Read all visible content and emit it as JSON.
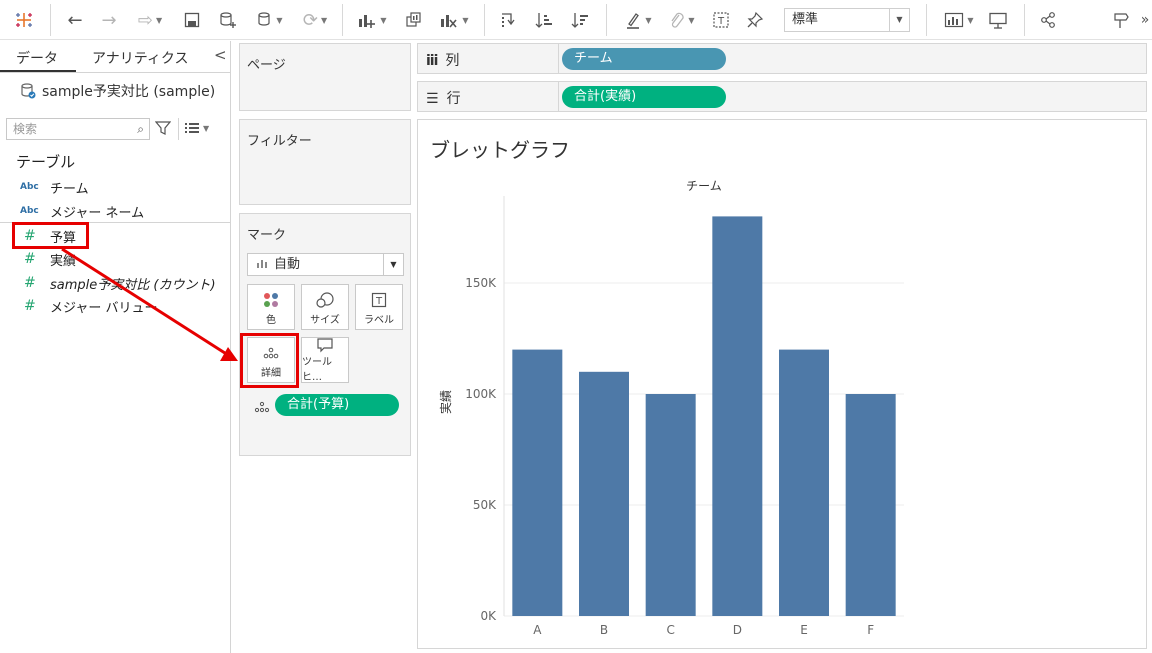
{
  "toolbar": {
    "fit": "標準",
    "colors": {
      "tableau": "#e8762b",
      "icon": "#555555"
    }
  },
  "data_pane": {
    "tabs": [
      "データ",
      "アナリティクス"
    ],
    "collapse": "<",
    "datasource": "sample予実対比 (sample)",
    "search_placeholder": "検索",
    "section": "テーブル",
    "dimensions": [
      {
        "type": "Abc",
        "name": "チーム"
      },
      {
        "type": "Abc",
        "name": "メジャー ネーム"
      }
    ],
    "measures": [
      {
        "type": "#",
        "name": "予算"
      },
      {
        "type": "#",
        "name": "実績"
      },
      {
        "type": "#",
        "name": "sample予実対比 (カウント)"
      },
      {
        "type": "#",
        "name": "メジャー バリュー"
      }
    ]
  },
  "pages": {
    "title": "ページ"
  },
  "filters": {
    "title": "フィルター"
  },
  "marks": {
    "title": "マーク",
    "type": "自動",
    "buttons": [
      "色",
      "サイズ",
      "ラベル",
      "詳細",
      "ツールヒ…"
    ],
    "detail_pill": "合計(予算)"
  },
  "shelves": {
    "columns": {
      "label": "列",
      "pill": "チーム"
    },
    "rows": {
      "label": "行",
      "pill": "合計(実績)"
    }
  },
  "view": {
    "title": "ブレットグラフ"
  },
  "chart_data": {
    "type": "bar",
    "title": "",
    "xlabel": "チーム",
    "ylabel": "実績",
    "categories": [
      "A",
      "B",
      "C",
      "D",
      "E",
      "F"
    ],
    "values": [
      120000,
      110000,
      100000,
      180000,
      120000,
      100000
    ],
    "ylim": [
      0,
      180000
    ],
    "yticks": [
      "0K",
      "50K",
      "100K",
      "150K"
    ],
    "bar_color": "#4e79a7",
    "grid": true
  }
}
